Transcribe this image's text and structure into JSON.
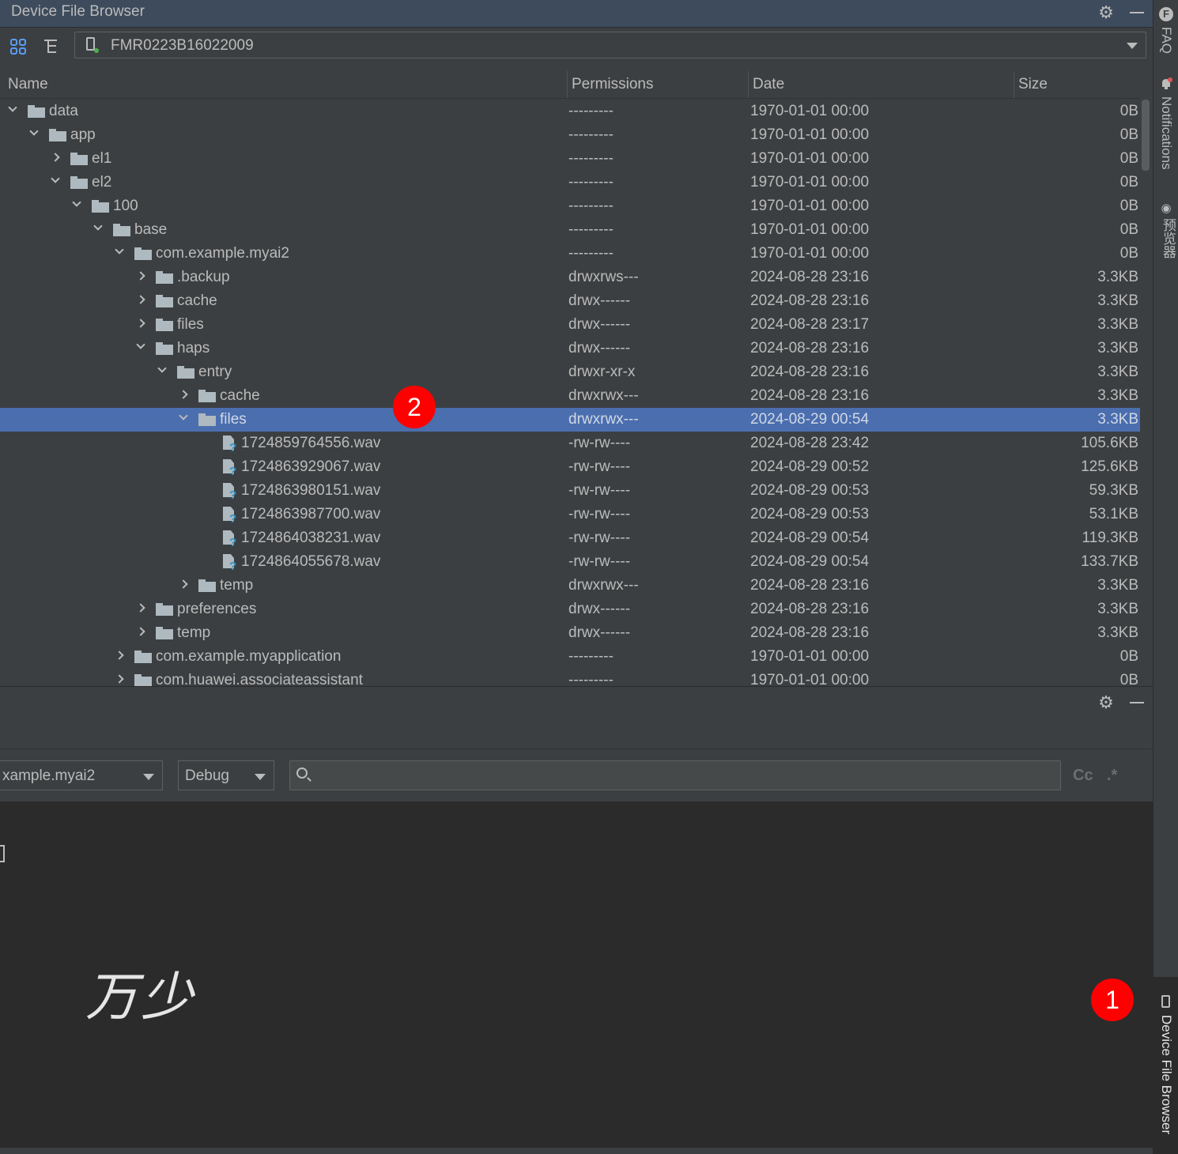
{
  "panel": {
    "title": "Device File Browser",
    "device": "FMR0223B16022009"
  },
  "columns": {
    "name": "Name",
    "permissions": "Permissions",
    "date": "Date",
    "size": "Size"
  },
  "rows": [
    {
      "name": "data",
      "type": "folder",
      "depth": 0,
      "expanded": true,
      "permissions": "---------",
      "date": "1970-01-01 00:00",
      "size": "0B"
    },
    {
      "name": "app",
      "type": "folder",
      "depth": 1,
      "expanded": true,
      "permissions": "---------",
      "date": "1970-01-01 00:00",
      "size": "0B"
    },
    {
      "name": "el1",
      "type": "folder",
      "depth": 2,
      "expanded": false,
      "permissions": "---------",
      "date": "1970-01-01 00:00",
      "size": "0B"
    },
    {
      "name": "el2",
      "type": "folder",
      "depth": 2,
      "expanded": true,
      "permissions": "---------",
      "date": "1970-01-01 00:00",
      "size": "0B"
    },
    {
      "name": "100",
      "type": "folder",
      "depth": 3,
      "expanded": true,
      "permissions": "---------",
      "date": "1970-01-01 00:00",
      "size": "0B"
    },
    {
      "name": "base",
      "type": "folder",
      "depth": 4,
      "expanded": true,
      "permissions": "---------",
      "date": "1970-01-01 00:00",
      "size": "0B"
    },
    {
      "name": "com.example.myai2",
      "type": "folder",
      "depth": 5,
      "expanded": true,
      "permissions": "---------",
      "date": "1970-01-01 00:00",
      "size": "0B"
    },
    {
      "name": ".backup",
      "type": "folder",
      "depth": 6,
      "expanded": false,
      "permissions": "drwxrws---",
      "date": "2024-08-28 23:16",
      "size": "3.3KB"
    },
    {
      "name": "cache",
      "type": "folder",
      "depth": 6,
      "expanded": false,
      "permissions": "drwx------",
      "date": "2024-08-28 23:16",
      "size": "3.3KB"
    },
    {
      "name": "files",
      "type": "folder",
      "depth": 6,
      "expanded": false,
      "permissions": "drwx------",
      "date": "2024-08-28 23:17",
      "size": "3.3KB"
    },
    {
      "name": "haps",
      "type": "folder",
      "depth": 6,
      "expanded": true,
      "permissions": "drwx------",
      "date": "2024-08-28 23:16",
      "size": "3.3KB"
    },
    {
      "name": "entry",
      "type": "folder",
      "depth": 7,
      "expanded": true,
      "permissions": "drwxr-xr-x",
      "date": "2024-08-28 23:16",
      "size": "3.3KB"
    },
    {
      "name": "cache",
      "type": "folder",
      "depth": 8,
      "expanded": false,
      "permissions": "drwxrwx---",
      "date": "2024-08-28 23:16",
      "size": "3.3KB"
    },
    {
      "name": "files",
      "type": "folder",
      "depth": 8,
      "expanded": true,
      "selected": true,
      "permissions": "drwxrwx---",
      "date": "2024-08-29 00:54",
      "size": "3.3KB"
    },
    {
      "name": "1724859764556.wav",
      "type": "file",
      "depth": 9,
      "permissions": "-rw-rw----",
      "date": "2024-08-28 23:42",
      "size": "105.6KB"
    },
    {
      "name": "1724863929067.wav",
      "type": "file",
      "depth": 9,
      "permissions": "-rw-rw----",
      "date": "2024-08-29 00:52",
      "size": "125.6KB"
    },
    {
      "name": "1724863980151.wav",
      "type": "file",
      "depth": 9,
      "permissions": "-rw-rw----",
      "date": "2024-08-29 00:53",
      "size": "59.3KB"
    },
    {
      "name": "1724863987700.wav",
      "type": "file",
      "depth": 9,
      "permissions": "-rw-rw----",
      "date": "2024-08-29 00:53",
      "size": "53.1KB"
    },
    {
      "name": "1724864038231.wav",
      "type": "file",
      "depth": 9,
      "permissions": "-rw-rw----",
      "date": "2024-08-29 00:54",
      "size": "119.3KB"
    },
    {
      "name": "1724864055678.wav",
      "type": "file",
      "depth": 9,
      "permissions": "-rw-rw----",
      "date": "2024-08-29 00:54",
      "size": "133.7KB"
    },
    {
      "name": "temp",
      "type": "folder",
      "depth": 8,
      "expanded": false,
      "permissions": "drwxrwx---",
      "date": "2024-08-28 23:16",
      "size": "3.3KB"
    },
    {
      "name": "preferences",
      "type": "folder",
      "depth": 6,
      "expanded": false,
      "permissions": "drwx------",
      "date": "2024-08-28 23:16",
      "size": "3.3KB"
    },
    {
      "name": "temp",
      "type": "folder",
      "depth": 6,
      "expanded": false,
      "permissions": "drwx------",
      "date": "2024-08-28 23:16",
      "size": "3.3KB"
    },
    {
      "name": "com.example.myapplication",
      "type": "folder",
      "depth": 5,
      "expanded": false,
      "permissions": "---------",
      "date": "1970-01-01 00:00",
      "size": "0B"
    },
    {
      "name": "com.huawei.associateassistant",
      "type": "folder",
      "depth": 5,
      "expanded": false,
      "permissions": "---------",
      "date": "1970-01-01 00:00",
      "size": "0B"
    }
  ],
  "log_panel": {
    "process_select": "xample.myai2",
    "level_select": "Debug",
    "search_value": "",
    "case_button": "Cc",
    "regex_button": ".*",
    "signature": "万少"
  },
  "right_strip": {
    "faq": "FAQ",
    "notifications": "Notifications",
    "previewer": "预览器",
    "device_file_browser": "Device File Browser"
  },
  "badges": {
    "one": "1",
    "two": "2"
  }
}
